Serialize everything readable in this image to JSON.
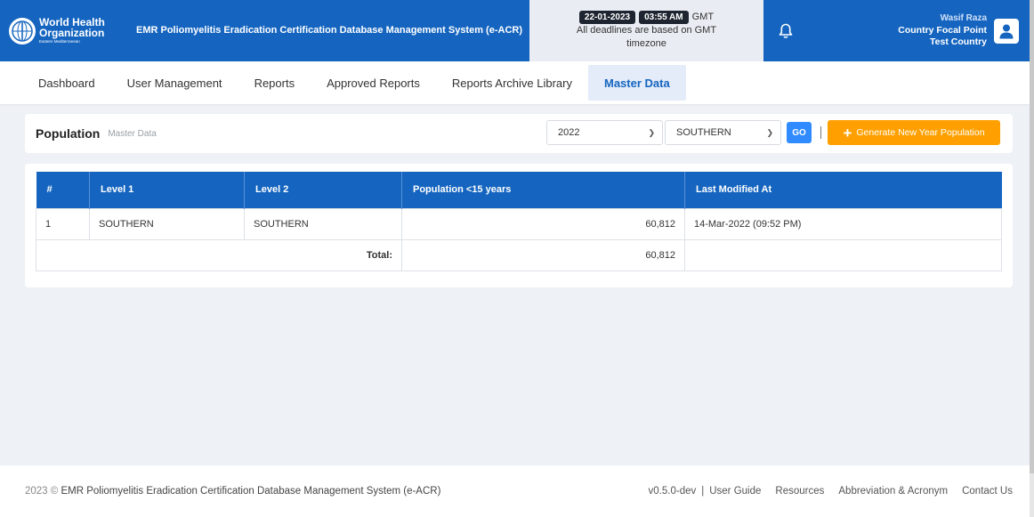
{
  "header": {
    "logo_line1": "World Health",
    "logo_line2": "Organization",
    "logo_line3": "Eastern Mediterranean",
    "app_title": "EMR Poliomyelitis Eradication Certification Database Management System (e-ACR)",
    "date": "22-01-2023",
    "time": "03:55 AM",
    "tz": "GMT",
    "deadline_note": "All deadlines are based on GMT timezone",
    "user_name": "Wasif Raza",
    "user_role": "Country Focal Point Test Country",
    "colors": {
      "brand": "#1565c0",
      "accent_orange": "#ffa000",
      "go_blue": "#2f8bff"
    },
    "icons": {
      "bell": "bell-icon",
      "avatar": "user-icon",
      "logo": "who-globe-icon"
    }
  },
  "nav": {
    "items": [
      {
        "label": "Dashboard"
      },
      {
        "label": "User Management"
      },
      {
        "label": "Reports"
      },
      {
        "label": "Approved Reports"
      },
      {
        "label": "Reports Archive Library"
      },
      {
        "label": "Master Data",
        "active": true
      }
    ]
  },
  "page": {
    "title": "Population",
    "subtitle": "Master Data",
    "year_selected": "2022",
    "region_selected": "SOUTHERN",
    "go_label": "GO",
    "generate_label": "Generate New Year Population"
  },
  "table": {
    "headers": [
      "#",
      "Level 1",
      "Level 2",
      "Population <15 years",
      "Last Modified At"
    ],
    "rows": [
      {
        "index": "1",
        "level1": "SOUTHERN",
        "level2": "SOUTHERN",
        "population": "60,812",
        "modified": "14-Mar-2022 (09:52 PM)"
      }
    ],
    "total_label": "Total:",
    "total_value": "60,812"
  },
  "footer": {
    "year": "2023 ©",
    "system_name": "EMR Poliomyelitis Eradication Certification Database Management System (e-ACR)",
    "version": "v0.5.0-dev",
    "divider": "|",
    "links": [
      "User Guide",
      "Resources",
      "Abbreviation & Acronym",
      "Contact Us"
    ]
  }
}
